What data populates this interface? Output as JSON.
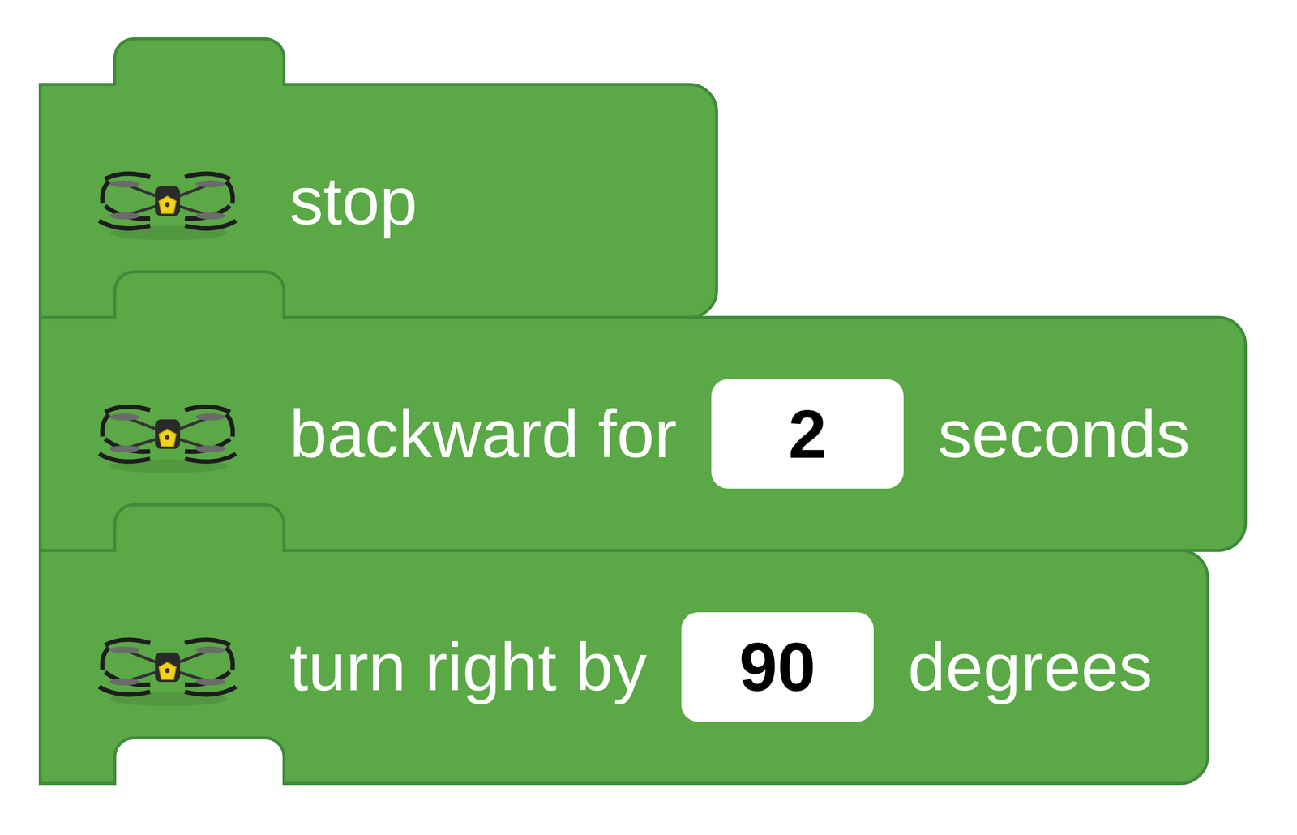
{
  "blocks": [
    {
      "parts": [
        {
          "kind": "label",
          "text": "stop"
        }
      ]
    },
    {
      "parts": [
        {
          "kind": "label",
          "text": "backward for"
        },
        {
          "kind": "input",
          "text": "2"
        },
        {
          "kind": "label",
          "text": "seconds"
        }
      ]
    },
    {
      "parts": [
        {
          "kind": "label",
          "text": "turn right by"
        },
        {
          "kind": "input",
          "text": "90"
        },
        {
          "kind": "label",
          "text": "degrees"
        }
      ]
    }
  ]
}
